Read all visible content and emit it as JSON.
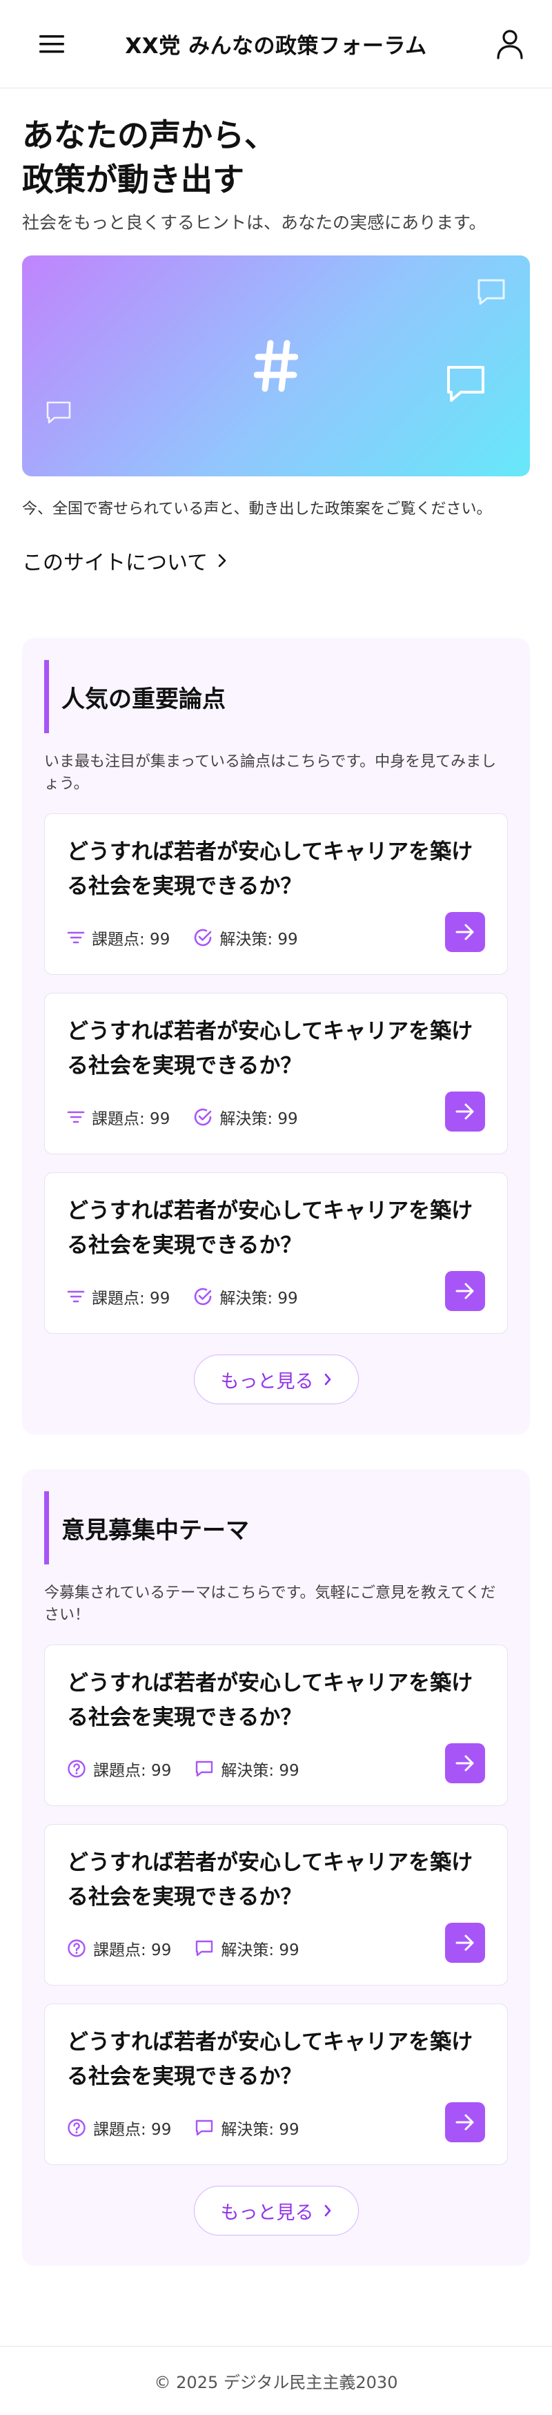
{
  "header": {
    "title": "XX党 みんなの政策フォーラム"
  },
  "hero": {
    "title_line1": "あなたの声から、",
    "title_line2": "政策が動き出す",
    "subtitle": "社会をもっと良くするヒントは、あなたの実感にあります。",
    "caption": "今、全国で寄せられている声と、動き出した政策案をご覧ください。",
    "about_link": "このサイトについて",
    "banner_symbol": "#"
  },
  "popular": {
    "title": "人気の重要論点",
    "description": "いま最も注目が集まっている論点はこちらです。中身を見てみましょう。",
    "cards": [
      {
        "question": "どうすれば若者が安心してキャリアを築ける社会を実現できるか？",
        "issues": "課題点: 99",
        "solutions": "解決策: 99"
      },
      {
        "question": "どうすれば若者が安心してキャリアを築ける社会を実現できるか？",
        "issues": "課題点: 99",
        "solutions": "解決策: 99"
      },
      {
        "question": "どうすれば若者が安心してキャリアを築ける社会を実現できるか？",
        "issues": "課題点: 99",
        "solutions": "解決策: 99"
      }
    ],
    "more_label": "もっと見る"
  },
  "recruiting": {
    "title": "意見募集中テーマ",
    "description": "今募集されているテーマはこちらです。気軽にご意見を教えてください！",
    "cards": [
      {
        "question": "どうすれば若者が安心してキャリアを築ける社会を実現できるか？",
        "issues": "課題点: 99",
        "solutions": "解決策: 99"
      },
      {
        "question": "どうすれば若者が安心してキャリアを築ける社会を実現できるか？",
        "issues": "課題点: 99",
        "solutions": "解決策: 99"
      },
      {
        "question": "どうすれば若者が安心してキャリアを築ける社会を実現できるか？",
        "issues": "課題点: 99",
        "solutions": "解決策: 99"
      }
    ],
    "more_label": "もっと見る"
  },
  "footer": {
    "text": "© 2025 デジタル民主主義2030"
  },
  "colors": {
    "accent": "#a855f7",
    "section_bg": "#faf5ff"
  }
}
